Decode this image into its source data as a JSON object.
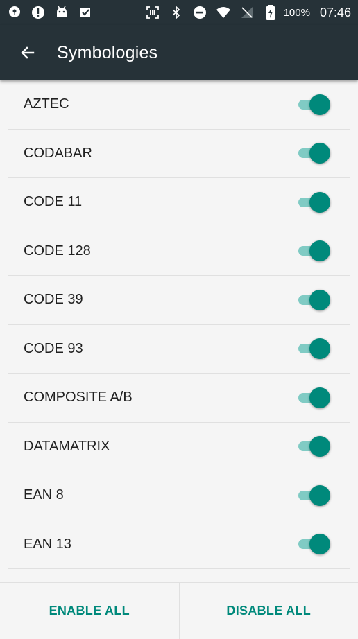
{
  "status_bar": {
    "left_icons": [
      "chat-bubble-icon",
      "alert-icon",
      "android-icon",
      "check-badge-icon"
    ],
    "right_icons": [
      "barcode-scanner-icon",
      "bluetooth-icon",
      "do-not-disturb-icon",
      "wifi-icon",
      "no-signal-icon",
      "battery-charging-icon"
    ],
    "battery": "100%",
    "time": "07:46"
  },
  "app_bar": {
    "title": "Symbologies"
  },
  "symbologies": [
    {
      "label": "AZTEC",
      "enabled": true
    },
    {
      "label": "CODABAR",
      "enabled": true
    },
    {
      "label": "CODE 11",
      "enabled": true
    },
    {
      "label": "CODE 128",
      "enabled": true
    },
    {
      "label": "CODE 39",
      "enabled": true
    },
    {
      "label": "CODE 93",
      "enabled": true
    },
    {
      "label": "COMPOSITE A/B",
      "enabled": true
    },
    {
      "label": "DATAMATRIX",
      "enabled": true
    },
    {
      "label": "EAN 8",
      "enabled": true
    },
    {
      "label": "EAN 13",
      "enabled": true
    }
  ],
  "actions": {
    "enable_all": "ENABLE ALL",
    "disable_all": "DISABLE ALL"
  },
  "colors": {
    "app_bar": "#263238",
    "accent": "#00897b",
    "switch_track": "#80cbc4"
  }
}
